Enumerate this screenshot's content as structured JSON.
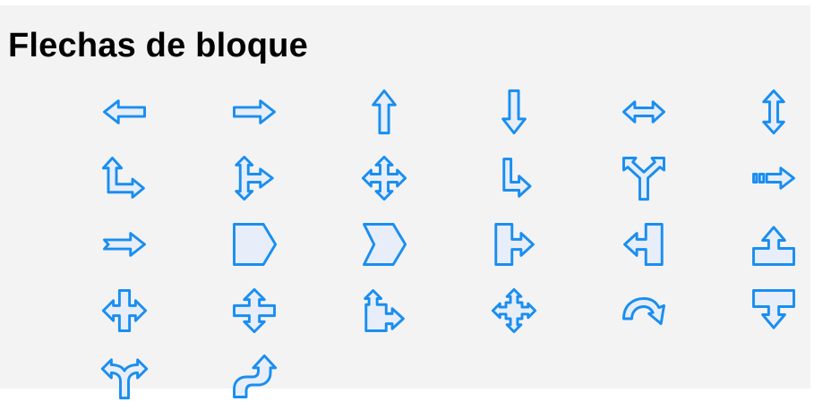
{
  "section": {
    "title": "Flechas de bloque"
  },
  "colors": {
    "icon_stroke": "#1a8ef0",
    "icon_fill": "#e7eef9",
    "background": "#f3f3f3"
  },
  "shapes": [
    {
      "name": "left-arrow-icon"
    },
    {
      "name": "right-arrow-icon"
    },
    {
      "name": "up-arrow-icon"
    },
    {
      "name": "down-arrow-icon"
    },
    {
      "name": "left-right-arrow-icon"
    },
    {
      "name": "up-down-arrow-icon"
    },
    {
      "name": "up-right-arrow-icon"
    },
    {
      "name": "up-right-down-arrow-icon"
    },
    {
      "name": "four-way-arrow-icon"
    },
    {
      "name": "corner-right-arrow-icon"
    },
    {
      "name": "split-arrow-icon"
    },
    {
      "name": "striped-right-arrow-icon"
    },
    {
      "name": "notched-right-arrow-icon"
    },
    {
      "name": "pentagon-icon"
    },
    {
      "name": "chevron-icon"
    },
    {
      "name": "right-arrow-callout-icon"
    },
    {
      "name": "left-arrow-callout-icon"
    },
    {
      "name": "up-arrow-callout-icon"
    },
    {
      "name": "left-right-arrow-callout-icon"
    },
    {
      "name": "up-down-arrow-callout-icon"
    },
    {
      "name": "up-right-arrow-callout-icon"
    },
    {
      "name": "four-way-arrow-callout-icon"
    },
    {
      "name": "circular-arrow-icon"
    },
    {
      "name": "down-arrow-callout-icon"
    },
    {
      "name": "split-round-arrow-icon"
    },
    {
      "name": "s-shaped-arrow-icon"
    }
  ]
}
